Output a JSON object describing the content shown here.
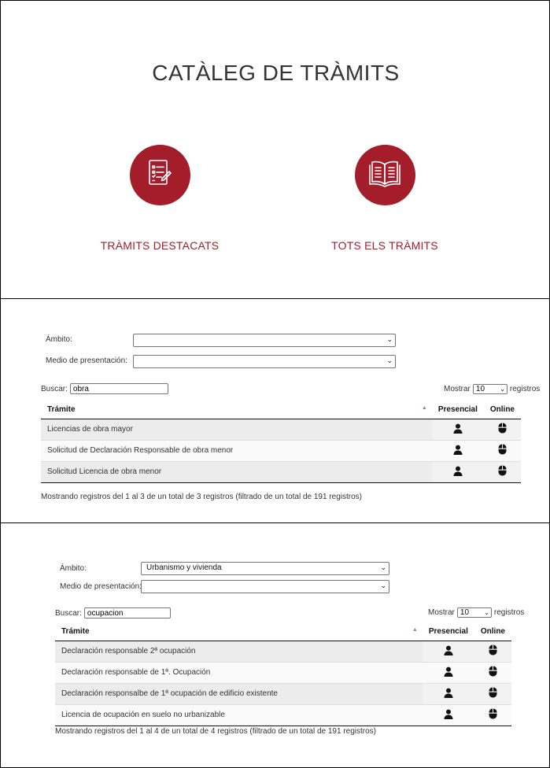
{
  "catalog": {
    "title": "CATÀLEG DE TRÀMITS",
    "cards": [
      {
        "label": "TRÀMITS DESTACATS",
        "icon": "checklist-document-icon"
      },
      {
        "label": "TOTS ELS TRÀMITS",
        "icon": "open-book-icon"
      }
    ],
    "accent": "#a31d2b"
  },
  "panel_a": {
    "ambito_label": "Ámbito:",
    "ambito_value": "",
    "medio_label": "Medio de presentación:",
    "medio_value": "",
    "search_label": "Buscar:",
    "search_value": "obra",
    "show_label": "Mostrar",
    "show_value": "10",
    "show_suffix": "registros",
    "columns": {
      "tramite": "Trámite",
      "presencial": "Presencial",
      "online": "Online"
    },
    "rows": [
      {
        "tramite": "Licencias de obra mayor",
        "presencial": "user-icon",
        "online": "mouse-icon"
      },
      {
        "tramite": "Solicitud de Declaración Responsable de obra menor",
        "presencial": "user-icon",
        "online": "mouse-icon"
      },
      {
        "tramite": "Solicitud Licencia de obra menor",
        "presencial": "user-icon",
        "online": "mouse-icon"
      }
    ],
    "info": "Mostrando registros del 1 al 3 de un total de 3 registros (filtrado de un total de 191 registros)"
  },
  "panel_b": {
    "ambito_label": "Ámbito:",
    "ambito_value": "Urbanismo y vivienda",
    "medio_label": "Medio de presentación:",
    "medio_value": "",
    "search_label": "Buscar:",
    "search_value": "ocupacion",
    "show_label": "Mostrar",
    "show_value": "10",
    "show_suffix": "registros",
    "columns": {
      "tramite": "Trámite",
      "presencial": "Presencial",
      "online": "Online"
    },
    "rows": [
      {
        "tramite": "Declaración responsable 2ª ocupación",
        "presencial": "user-icon",
        "online": "mouse-icon"
      },
      {
        "tramite": "Declaración responsable de 1ª. Ocupación",
        "presencial": "user-icon",
        "online": "mouse-icon"
      },
      {
        "tramite": "Declaración responsalbe de 1ª ocupación de edificio existente",
        "presencial": "user-icon",
        "online": "mouse-icon"
      },
      {
        "tramite": "Licencia de ocupación en suelo no urbanizable",
        "presencial": "user-icon",
        "online": "mouse-icon"
      }
    ],
    "info": "Mostrando registros del 1 al 4 de un total de 4 registros (filtrado de un total de 191 registros)"
  }
}
